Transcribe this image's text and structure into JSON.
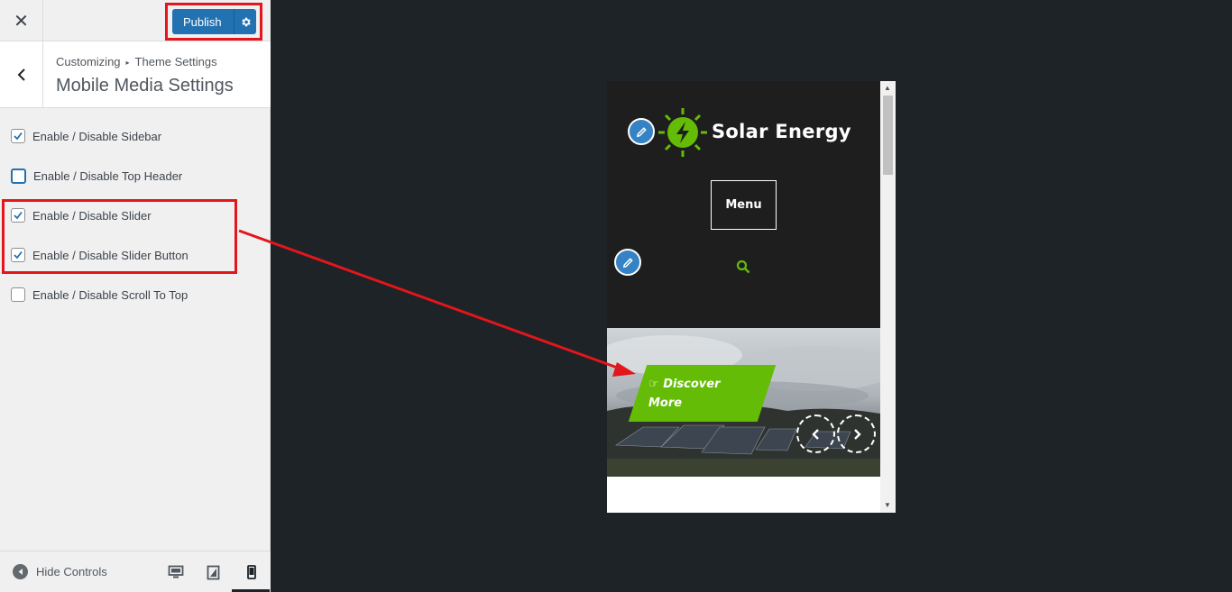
{
  "topbar": {
    "close_label": "✕",
    "publish_label": "Publish"
  },
  "section": {
    "breadcrumb_root": "Customizing",
    "breadcrumb_sep": "▸",
    "breadcrumb_current": "Theme Settings",
    "title": "Mobile Media Settings"
  },
  "controls": [
    {
      "label": "Enable / Disable Sidebar",
      "checked": true
    },
    {
      "label": "Enable / Disable Top Header",
      "checked": false
    },
    {
      "label": "Enable / Disable Slider",
      "checked": true
    },
    {
      "label": "Enable / Disable Slider Button",
      "checked": true
    },
    {
      "label": "Enable / Disable Scroll To Top",
      "checked": false
    }
  ],
  "footer": {
    "hide_controls_label": "Hide Controls",
    "devices": [
      "desktop-icon",
      "tablet-icon",
      "mobile-icon"
    ],
    "active_device": "mobile"
  },
  "preview": {
    "site_title": "Solar Energy",
    "menu_label": "Menu",
    "slider_button_label": "Discover More"
  },
  "colors": {
    "accent": "#2271b1",
    "highlight": "#e2161b",
    "brand_green": "#64bc06"
  }
}
